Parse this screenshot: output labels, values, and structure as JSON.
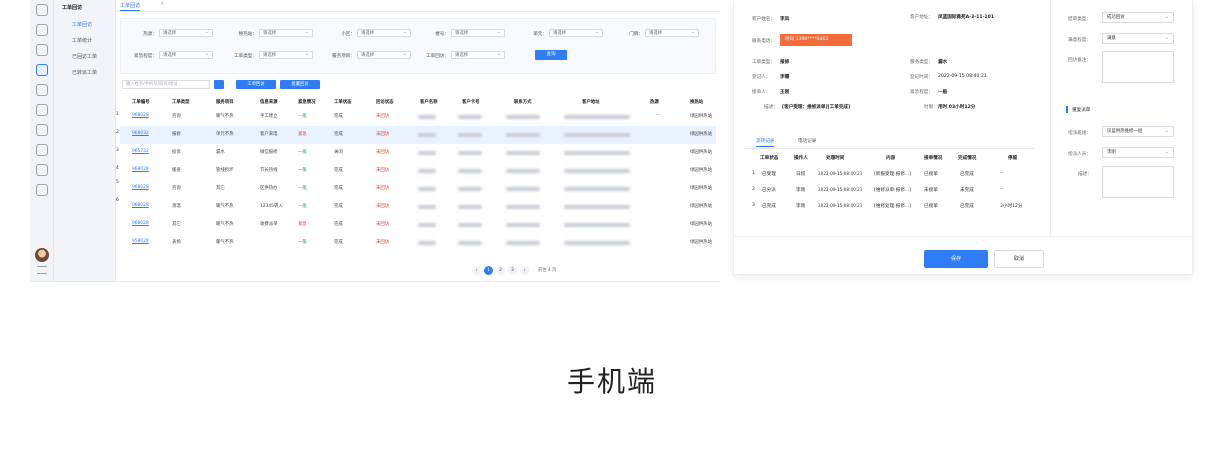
{
  "left": {
    "menu": {
      "title": "工单回访",
      "items": [
        "工单回访",
        "工单统计",
        "已回访工单",
        "已转派工单"
      ]
    },
    "tab": {
      "label": "工单回访",
      "close": "×"
    },
    "filters": {
      "row1": [
        {
          "label": "热源：",
          "value": "请选择"
        },
        {
          "label": "换热站：",
          "value": "请选择"
        },
        {
          "label": "小区：",
          "value": "请选择"
        },
        {
          "label": "楼号：",
          "value": "请选择"
        },
        {
          "label": "单元：",
          "value": "请选择"
        },
        {
          "label": "门牌：",
          "value": "请选择"
        }
      ],
      "row2": [
        {
          "label": "紧急程度：",
          "value": "请选择"
        },
        {
          "label": "工单类型：",
          "value": "请选择"
        },
        {
          "label": "服务项目：",
          "value": "请选择"
        },
        {
          "label": "工单回访：",
          "value": "请选择"
        }
      ],
      "search_button": "查询"
    },
    "searchbar": {
      "placeholder": "输入姓名/手机号/房号/地址"
    },
    "actions": {
      "assign": "工单回访",
      "import": "批量回访"
    },
    "table": {
      "headers": [
        "工单编号",
        "工单类型",
        "服务项目",
        "信息来源",
        "紧急情况",
        "工单状态",
        "回访状态",
        "客户名称",
        "客户卡号",
        "联系方式",
        "客户地址",
        "热源",
        "换热站"
      ],
      "rows": [
        {
          "num": "1",
          "id": "968028",
          "type": "咨询",
          "service": "暖气不热",
          "source": "手工建立",
          "urgent": "一般",
          "urgent_color": "green",
          "status": "完成",
          "visit": "未回访",
          "heat": "--",
          "station": "绿园供热站"
        },
        {
          "num": "2",
          "id": "968032",
          "type": "报修",
          "service": "单元不热",
          "source": "客户来电",
          "urgent": "紧急",
          "urgent_color": "red",
          "status": "完成",
          "visit": "未回访",
          "heat": "",
          "station": "绿园供热站"
        },
        {
          "num": "3",
          "id": "965732",
          "type": "投诉",
          "service": "漏水",
          "source": "微信报修",
          "urgent": "一般",
          "urgent_color": "green",
          "status": "关闭",
          "visit": "未回访",
          "heat": "",
          "station": "绿园供热站"
        },
        {
          "num": "4",
          "id": "968028",
          "type": "缓查",
          "service": "管线损坏",
          "source": "节长热线",
          "urgent": "一般",
          "urgent_color": "green",
          "status": "完成",
          "visit": "未回访",
          "heat": "",
          "station": "绿园供热站"
        },
        {
          "num": "5",
          "id": "968028",
          "type": "咨询",
          "service": "其它",
          "source": "区供热办",
          "urgent": "一般",
          "urgent_color": "green",
          "status": "完成",
          "visit": "未回访",
          "heat": "",
          "station": "绿园供热站"
        },
        {
          "num": "6",
          "id": "968028",
          "type": "测温",
          "service": "暖气不热",
          "source": "12345转入",
          "urgent": "一般",
          "urgent_color": "green",
          "status": "完成",
          "visit": "未回访",
          "heat": "",
          "station": "绿园供热站"
        },
        {
          "num": "",
          "id": "968028",
          "type": "其它",
          "service": "暖气不热",
          "source": "收费派单",
          "urgent": "紧急",
          "urgent_color": "red",
          "status": "完成",
          "visit": "未回访",
          "heat": "",
          "station": "绿园供热站"
        },
        {
          "num": "",
          "id": "958028",
          "type": "表扬",
          "service": "暖气不热",
          "source": "",
          "urgent": "一般",
          "urgent_color": "green",
          "status": "完成",
          "visit": "未回访",
          "heat": "",
          "station": "绿园供热站"
        }
      ]
    },
    "pager": {
      "pages": [
        "1",
        "2",
        "3"
      ],
      "current": "1",
      "prev": "‹",
      "next": "›",
      "total": "前往 4 页"
    }
  },
  "right": {
    "customer_name_label": "客户姓名：",
    "customer_name": "李凤",
    "address_label": "客户地址：",
    "address": "凤蓝国际雅苑A-3-11-101",
    "phone_label": "联系电话：",
    "phone_button": "呼叫 1390****9463",
    "order_type_label": "工单类型：",
    "order_type": "报修",
    "service_type_label": "服务类型：",
    "service_type": "漏水",
    "registrar_label": "登记人：",
    "registrar": "李曝",
    "reg_time_label": "登记时间：",
    "reg_time": "2022-09-15 08:40:21",
    "receiver_label": "接单人：",
    "receiver": "王刚",
    "urgency_label": "紧急程度：",
    "urgency": "一般",
    "desc_label": "描述：",
    "desc": "[客户受理：维修派单][工单完成]",
    "duration_label": "时限：",
    "duration": "用时 03小时12分",
    "result_type_label": "结单类型：",
    "result_type": "成功回访",
    "satisfaction_label": "满意程度：",
    "satisfaction": "满意",
    "remark_label": "回访备注：",
    "section_title": "重复派单",
    "dispatch_dept_label": "指派班组：",
    "dispatch_dept": "凤蓝供热维修一组",
    "dispatch_person_label": "指派人员：",
    "dispatch_person": "李刚",
    "desc2_label": "描述：",
    "tabs": [
      "流转记录",
      "电话记录"
    ],
    "flow_headers": [
      "工单状态",
      "操作人",
      "处理时间",
      "内容",
      "接单情况",
      "完成情况",
      "停留"
    ],
    "flow_rows": [
      {
        "num": "1",
        "state": "已受理",
        "op": "日叔",
        "time": "2022-09-15 08:40:21",
        "content": "[新报受理:报修...]",
        "accept": "已接单",
        "done": "已完成",
        "stay": "--"
      },
      {
        "num": "2",
        "state": "已分派",
        "op": "李刚",
        "time": "2022-09-15 08:40:21",
        "content": "[维修派单:报修...]",
        "accept": "未接单",
        "done": "未完成",
        "stay": "--"
      },
      {
        "num": "3",
        "state": "已完成",
        "op": "李刚",
        "time": "2022-09-15 08:40:21",
        "content": "[维修处理:报修...]",
        "accept": "已接单",
        "done": "已完成",
        "stay": "3小时12分"
      }
    ],
    "save": "保存",
    "cancel": "取消"
  },
  "caption": "手机端",
  "colors": {
    "accent": "#2f7df6",
    "danger": "#e23b3b",
    "ok": "#27a34b",
    "call": "#f56b3a"
  }
}
